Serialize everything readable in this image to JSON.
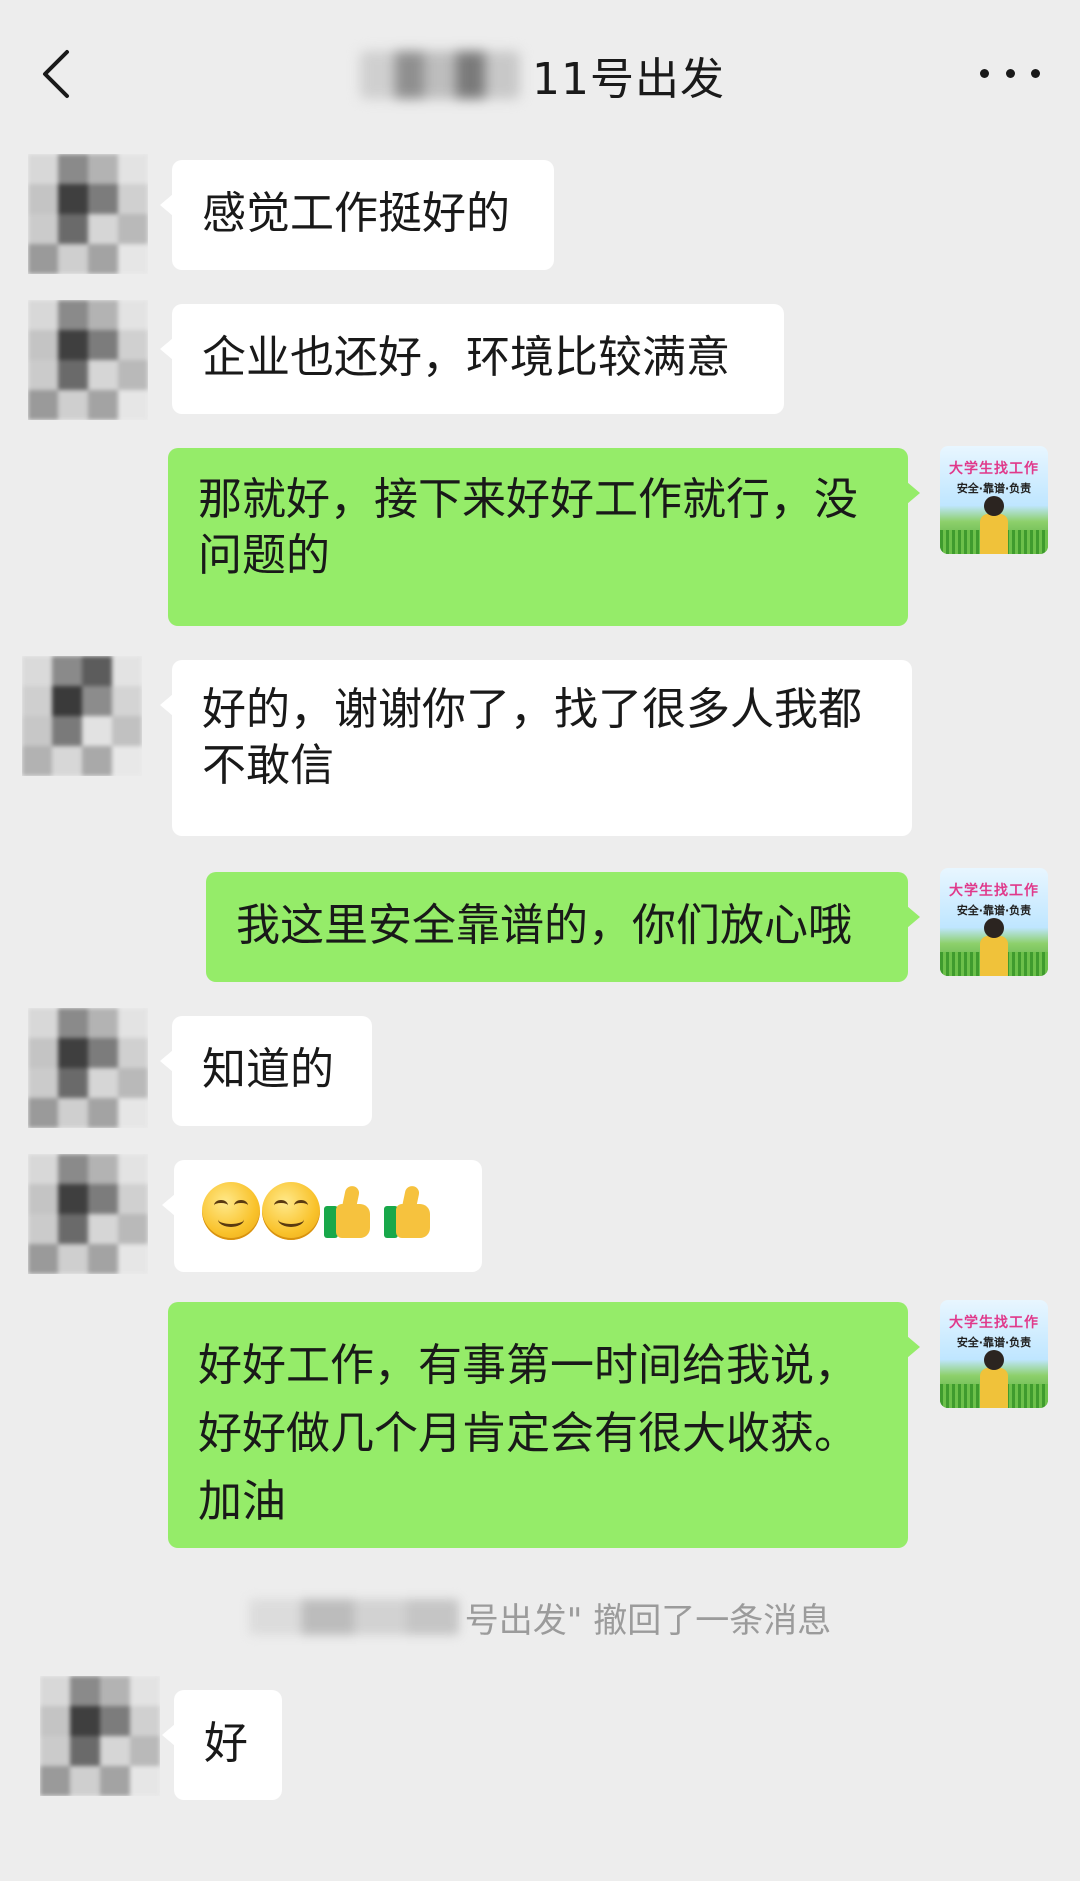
{
  "header": {
    "title": "11号出发"
  },
  "messages": [
    {
      "side": "left",
      "text": "感觉工作挺好的"
    },
    {
      "side": "left",
      "text": "企业也还好，环境比较满意"
    },
    {
      "side": "right",
      "text": "那就好，接下来好好工作就行，没问题的"
    },
    {
      "side": "left",
      "text": "好的，谢谢你了，找了很多人我都不敢信"
    },
    {
      "side": "right",
      "text": "我这里安全靠谱的，你们放心哦"
    },
    {
      "side": "left",
      "text": "知道的"
    },
    {
      "side": "left",
      "emoji": [
        "smile-emoji",
        "smile-emoji",
        "thumbs-up-emoji",
        "thumbs-up-emoji"
      ]
    },
    {
      "side": "right",
      "text": "好好工作，有事第一时间给我说，好好做几个月肯定会有很大收获。加油"
    },
    {
      "side": "left",
      "text": "好"
    }
  ],
  "recall_notice": "号出发\" 撤回了一条消息",
  "self_avatar": {
    "line1": "大学生找工作",
    "line2": "安全·靠谱·负责"
  },
  "colors": {
    "background": "#ededed",
    "sent_bubble": "#95ec69",
    "received_bubble": "#ffffff",
    "system_text": "#9b9b9b"
  }
}
